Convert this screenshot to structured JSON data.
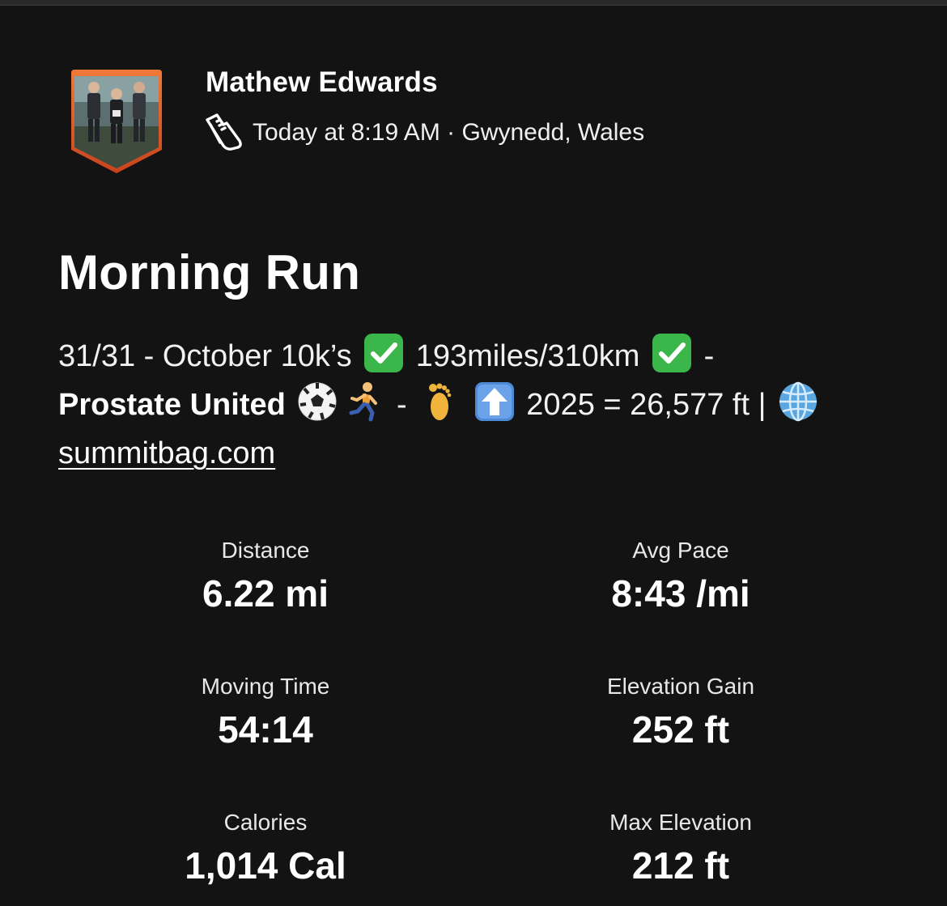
{
  "header": {
    "athlete_name": "Mathew Edwards",
    "activity_icon": "running-shoe-icon",
    "meta": "Today at 8:19 AM · Gwynedd, Wales"
  },
  "activity": {
    "title": "Morning Run",
    "description": {
      "part1": "31/31 - October 10k’s",
      "part2": "193miles/310km",
      "part3": "-",
      "bold": "Prostate United",
      "part4": "-",
      "part5": "2025 = 26,577 ft |",
      "link": "summitbag.com"
    },
    "emojis": [
      "check-mark-emoji",
      "check-mark-emoji",
      "soccer-ball-emoji",
      "runner-emoji",
      "foot-emoji",
      "up-arrow-emoji",
      "globe-emoji"
    ]
  },
  "stats": [
    {
      "label": "Distance",
      "value": "6.22 mi"
    },
    {
      "label": "Avg Pace",
      "value": "8:43 /mi"
    },
    {
      "label": "Moving Time",
      "value": "54:14"
    },
    {
      "label": "Elevation Gain",
      "value": "252 ft"
    },
    {
      "label": "Calories",
      "value": "1,014 Cal"
    },
    {
      "label": "Max Elevation",
      "value": "212 ft"
    }
  ],
  "colors": {
    "background": "#131313",
    "avatar_border": "#e4602a",
    "check_green": "#3bb64a"
  }
}
